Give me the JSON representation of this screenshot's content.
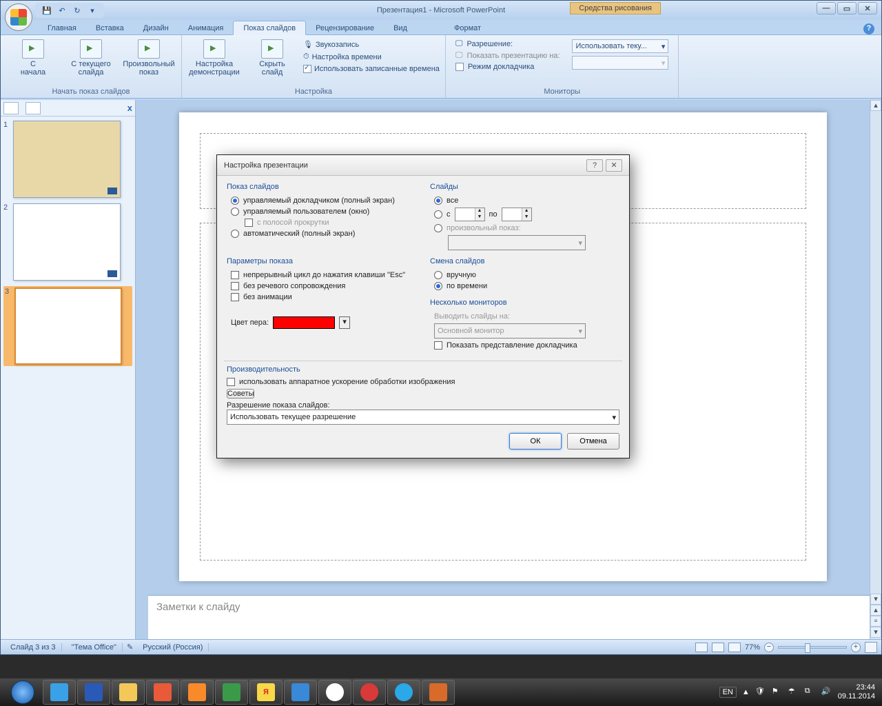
{
  "title": "Презентация1 - Microsoft PowerPoint",
  "context_tab": "Средства рисования",
  "tabs": [
    "Главная",
    "Вставка",
    "Дизайн",
    "Анимация",
    "Показ слайдов",
    "Рецензирование",
    "Вид",
    "Формат"
  ],
  "active_tab": "Показ слайдов",
  "ribbon": {
    "group1": {
      "label": "Начать показ слайдов",
      "btn1": "С\nначала",
      "btn2": "С текущего\nслайда",
      "btn3": "Произвольный\nпоказ"
    },
    "group2": {
      "label": "Настройка",
      "btn1": "Настройка\nдемонстрации",
      "btn2": "Скрыть\nслайд",
      "row1": "Звукозапись",
      "row2": "Настройка времени",
      "row3": "Использовать записанные времена"
    },
    "group3": {
      "label": "Мониторы",
      "row1": "Разрешение:",
      "dd1": "Использовать теку...",
      "row2": "Показать презентацию на:",
      "row3": "Режим докладчика"
    }
  },
  "slides_count": "Слайд 3 из 3",
  "theme": "\"Тема Office\"",
  "lang_status": "Русский (Россия)",
  "notes_placeholder": "Заметки к слайду",
  "zoom": "77%",
  "dialog": {
    "title": "Настройка презентации",
    "g_show": "Показ слайдов",
    "r1": "управляемый докладчиком (полный экран)",
    "r2": "управляемый пользователем (окно)",
    "r2a": "с полосой прокрутки",
    "r3": "автоматический (полный экран)",
    "g_slides": "Слайды",
    "s_all": "все",
    "s_from": "с",
    "s_to": "по",
    "s_custom": "произвольный показ:",
    "g_opts": "Параметры показа",
    "o1": "непрерывный цикл до нажатия клавиши \"Esc\"",
    "o2": "без речевого сопровождения",
    "o3": "без анимации",
    "pen": "Цвет пера:",
    "g_adv": "Смена слайдов",
    "a1": "вручную",
    "a2": "по времени",
    "g_mon": "Несколько мониторов",
    "m_lbl": "Выводить слайды на:",
    "m_dd": "Основной монитор",
    "m_chk": "Показать представление докладчика",
    "g_perf": "Производительность",
    "p_chk": "использовать аппаратное ускорение обработки изображения",
    "p_btn": "Советы",
    "p_res": "Разрешение показа слайдов:",
    "p_dd": "Использовать текущее разрешение",
    "ok": "ОК",
    "cancel": "Отмена"
  },
  "taskbar": {
    "lang": "EN",
    "time": "23:44",
    "date": "09.11.2014"
  }
}
